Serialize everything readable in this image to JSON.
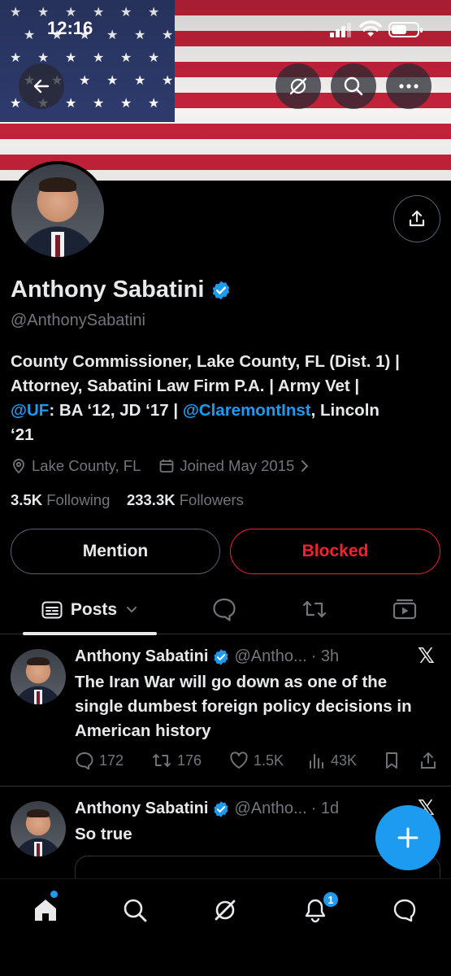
{
  "status_bar": {
    "time": "12:16"
  },
  "profile": {
    "name": "Anthony Sabatini",
    "handle": "@AnthonySabatini",
    "bio": {
      "line1": "County Commissioner, Lake County, FL (Dist. 1) |",
      "line2": "Attorney, Sabatini Law Firm P.A. | Army Vet |",
      "mention_uf": "@UF",
      "line3_mid": ": BA ‘12, JD ‘17 | ",
      "mention_claremont": "@ClaremontInst",
      "line3_end": ", Lincoln",
      "line4": "‘21"
    },
    "location": "Lake County, FL",
    "joined": "Joined May 2015",
    "following_count": "3.5K",
    "following_label": "Following",
    "followers_count": "233.3K",
    "followers_label": "Followers",
    "mention_button": "Mention",
    "blocked_button": "Blocked"
  },
  "tabs": {
    "posts_label": "Posts"
  },
  "posts": [
    {
      "name": "Anthony Sabatini",
      "handle": "@Antho...",
      "time": "· 3h",
      "text": "The Iran War will go down as one of the single dumbest foreign policy decisions in American history",
      "replies": "172",
      "reposts": "176",
      "likes": "1.5K",
      "views": "43K"
    },
    {
      "name": "Anthony Sabatini",
      "handle": "@Antho...",
      "time": "· 1d",
      "text": "So true"
    }
  ],
  "bottom_nav": {
    "notifications_badge": "1"
  },
  "colors": {
    "accent": "#1d9bf0",
    "blocked": "#f4212e",
    "muted": "#71767b"
  }
}
